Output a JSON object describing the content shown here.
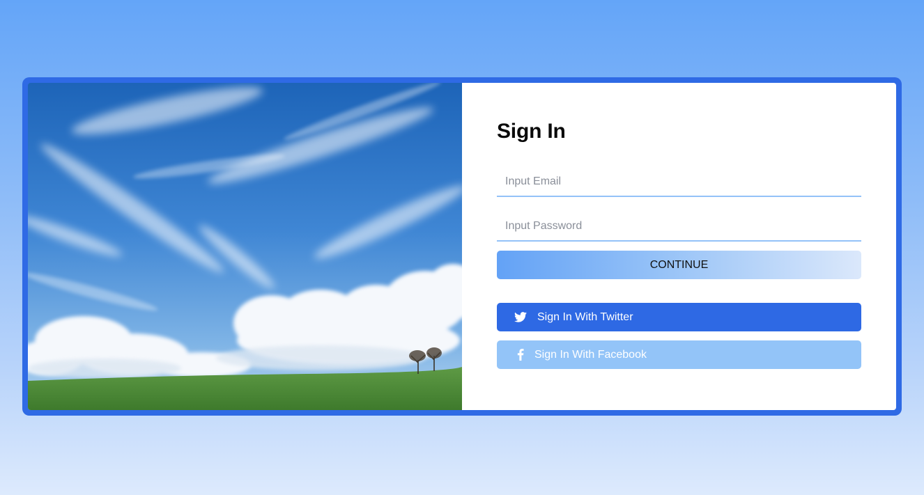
{
  "signin": {
    "title": "Sign In",
    "email_placeholder": "Input Email",
    "password_placeholder": "Input Password",
    "continue_label": "CONTINUE",
    "twitter_label": "Sign In With Twitter",
    "facebook_label": "Sign In With Facebook"
  },
  "icons": {
    "twitter": "twitter-icon",
    "facebook": "facebook-icon"
  },
  "colors": {
    "accent": "#2e69e4",
    "facebook_button": "#93c4f8",
    "input_underline": "#93c2f8"
  }
}
